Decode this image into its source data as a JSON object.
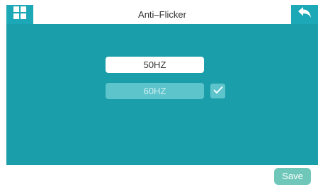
{
  "header": {
    "title": "Anti–Flicker",
    "menu_icon": "grid-menu-icon",
    "back_icon": "back-arrow-icon"
  },
  "options": [
    {
      "label": "50HZ",
      "selected": true
    },
    {
      "label": "60HZ",
      "selected": false,
      "checked": true
    }
  ],
  "footer": {
    "save_label": "Save"
  },
  "colors": {
    "accent": "#1ca8b6",
    "panel": "#1a9ea9",
    "save_button": "#6fc7b9"
  }
}
